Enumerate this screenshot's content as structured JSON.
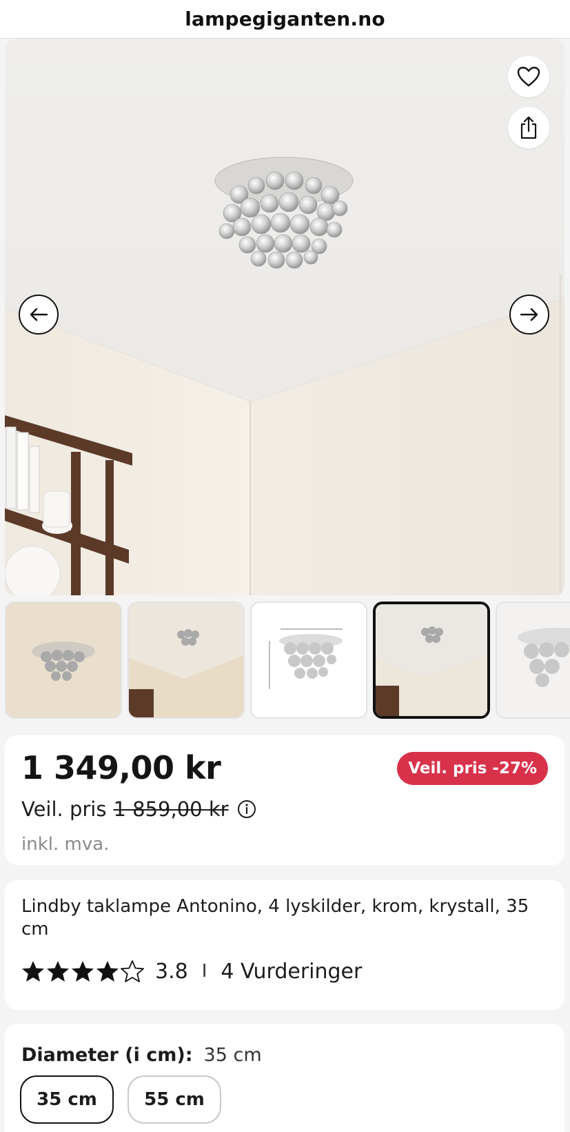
{
  "browser": {
    "url": "lampegiganten.no"
  },
  "gallery": {
    "icons": {
      "favorite": "heart-icon",
      "share": "share-icon",
      "prev": "arrow-left-icon",
      "next": "arrow-right-icon"
    },
    "thumbnail_count_visible": 5,
    "active_thumbnail": 4
  },
  "price": {
    "current": "1 349,00 kr",
    "badge": "Veil. pris -27%",
    "recommended_label": "Veil. pris",
    "recommended_old": "1 859,00 kr",
    "vat": "inkl. mva."
  },
  "product": {
    "title": "Lindby taklampe Antonino, 4 lyskilder, krom, krystall, 35 cm",
    "rating": 3.8,
    "rating_text": "3.8",
    "separator": "I",
    "reviews": "4 Vurderinger"
  },
  "options": {
    "label": "Diameter (i cm):",
    "selected_value": "35 cm",
    "sizes": [
      "35 cm",
      "55 cm"
    ]
  },
  "colors": {
    "badge": "#d8324b",
    "text": "#1c1c1c",
    "muted": "#8a8a8a"
  }
}
